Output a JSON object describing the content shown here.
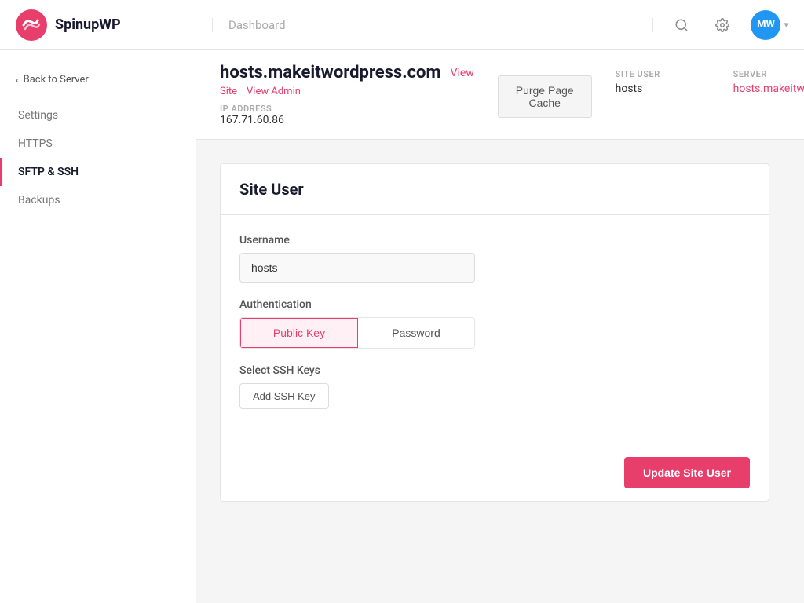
{
  "app": {
    "name": "SpinupWP"
  },
  "topnav": {
    "dashboard_label": "Dashboard",
    "search_icon": "🔍",
    "gear_icon": "⚙",
    "user_initials": "MW",
    "chevron": "▾"
  },
  "sidebar": {
    "back_label": "Back to Server",
    "items": [
      {
        "id": "settings",
        "label": "Settings",
        "active": false
      },
      {
        "id": "https",
        "label": "HTTPS",
        "active": false
      },
      {
        "id": "sftp-ssh",
        "label": "SFTP & SSH",
        "active": true
      },
      {
        "id": "backups",
        "label": "Backups",
        "active": false
      }
    ]
  },
  "site_header": {
    "hostname": "hosts.makeitwordpress.com",
    "view_label": "View",
    "site_label": "Site",
    "view_admin_label": "View Admin",
    "ip_address_label": "IP ADDRESS",
    "ip_address": "167.71.60.86",
    "purge_cache_label": "Purge Page Cache",
    "site_user_label": "SITE USER",
    "site_user_value": "hosts",
    "server_label": "SERVER",
    "server_value": "hosts.makeitwordpress.com"
  },
  "form": {
    "card_title": "Site User",
    "username_label": "Username",
    "username_value": "hosts",
    "username_placeholder": "hosts",
    "authentication_label": "Authentication",
    "public_key_label": "Public Key",
    "password_label": "Password",
    "select_ssh_label": "Select SSH Keys",
    "add_ssh_label": "Add SSH Key",
    "update_button_label": "Update Site User"
  }
}
